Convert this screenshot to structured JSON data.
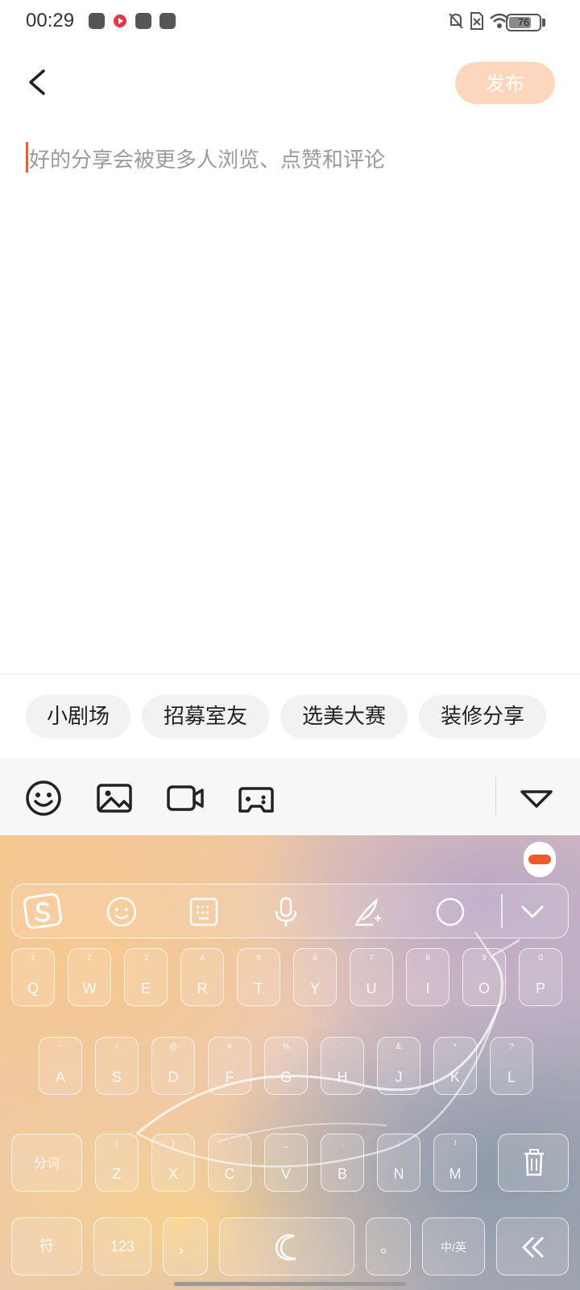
{
  "status_bar": {
    "time": "00:29",
    "battery": "76",
    "battery_level": 0.76,
    "notification_icons": [
      "douyin-icon",
      "video-app-icon",
      "douyin-icon",
      "capcut-icon"
    ],
    "system_icons": [
      "mute-bell-icon",
      "no-sim-icon",
      "wifi-icon",
      "battery-icon"
    ]
  },
  "header": {
    "back_icon": "chevron-left-icon",
    "publish_label": "发布",
    "publish_color": "#fdd7bd"
  },
  "editor": {
    "placeholder": "好的分享会被更多人浏览、点赞和评论",
    "cursor_color": "#ff5a1f"
  },
  "topics": [
    "小剧场",
    "招募室友",
    "选美大赛",
    "装修分享"
  ],
  "toolbar": {
    "icons": [
      "emoji-icon",
      "image-icon",
      "video-icon",
      "gamepad-icon",
      "collapse-icon"
    ]
  },
  "keyboard": {
    "top_icons": [
      "sogou-logo-icon",
      "emoji-icon",
      "keyboard-layout-icon",
      "microphone-icon",
      "handwriting-icon",
      "search-icon",
      "hide-keyboard-icon"
    ],
    "row1": [
      {
        "key": "Q",
        "sub": "1"
      },
      {
        "key": "W",
        "sub": "2"
      },
      {
        "key": "E",
        "sub": "3"
      },
      {
        "key": "R",
        "sub": "4"
      },
      {
        "key": "T",
        "sub": "5"
      },
      {
        "key": "Y",
        "sub": "6"
      },
      {
        "key": "U",
        "sub": "7"
      },
      {
        "key": "I",
        "sub": "8"
      },
      {
        "key": "O",
        "sub": "9"
      },
      {
        "key": "P",
        "sub": "0"
      }
    ],
    "row2": [
      {
        "key": "A",
        "sub": "~"
      },
      {
        "key": "S",
        "sub": "!"
      },
      {
        "key": "D",
        "sub": "@"
      },
      {
        "key": "F",
        "sub": "#"
      },
      {
        "key": "G",
        "sub": "%"
      },
      {
        "key": "H",
        "sub": "'"
      },
      {
        "key": "J",
        "sub": "&"
      },
      {
        "key": "K",
        "sub": "*"
      },
      {
        "key": "L",
        "sub": "?"
      }
    ],
    "row3": [
      {
        "key": "Z",
        "sub": "("
      },
      {
        "key": "X",
        "sub": ")"
      },
      {
        "key": "C",
        "sub": "-"
      },
      {
        "key": "V",
        "sub": "_"
      },
      {
        "key": "B",
        "sub": ":"
      },
      {
        "key": "N",
        "sub": ";"
      },
      {
        "key": "M",
        "sub": "/"
      }
    ],
    "split_label": "分词",
    "symbol_label": "符",
    "number_label": "123",
    "comma_label": "，",
    "period_label": "。",
    "lang_label": "中/英",
    "delete_icon": "trash-icon",
    "enter_icon": "double-chevron-left-icon",
    "space_icon": "moon-icon"
  }
}
